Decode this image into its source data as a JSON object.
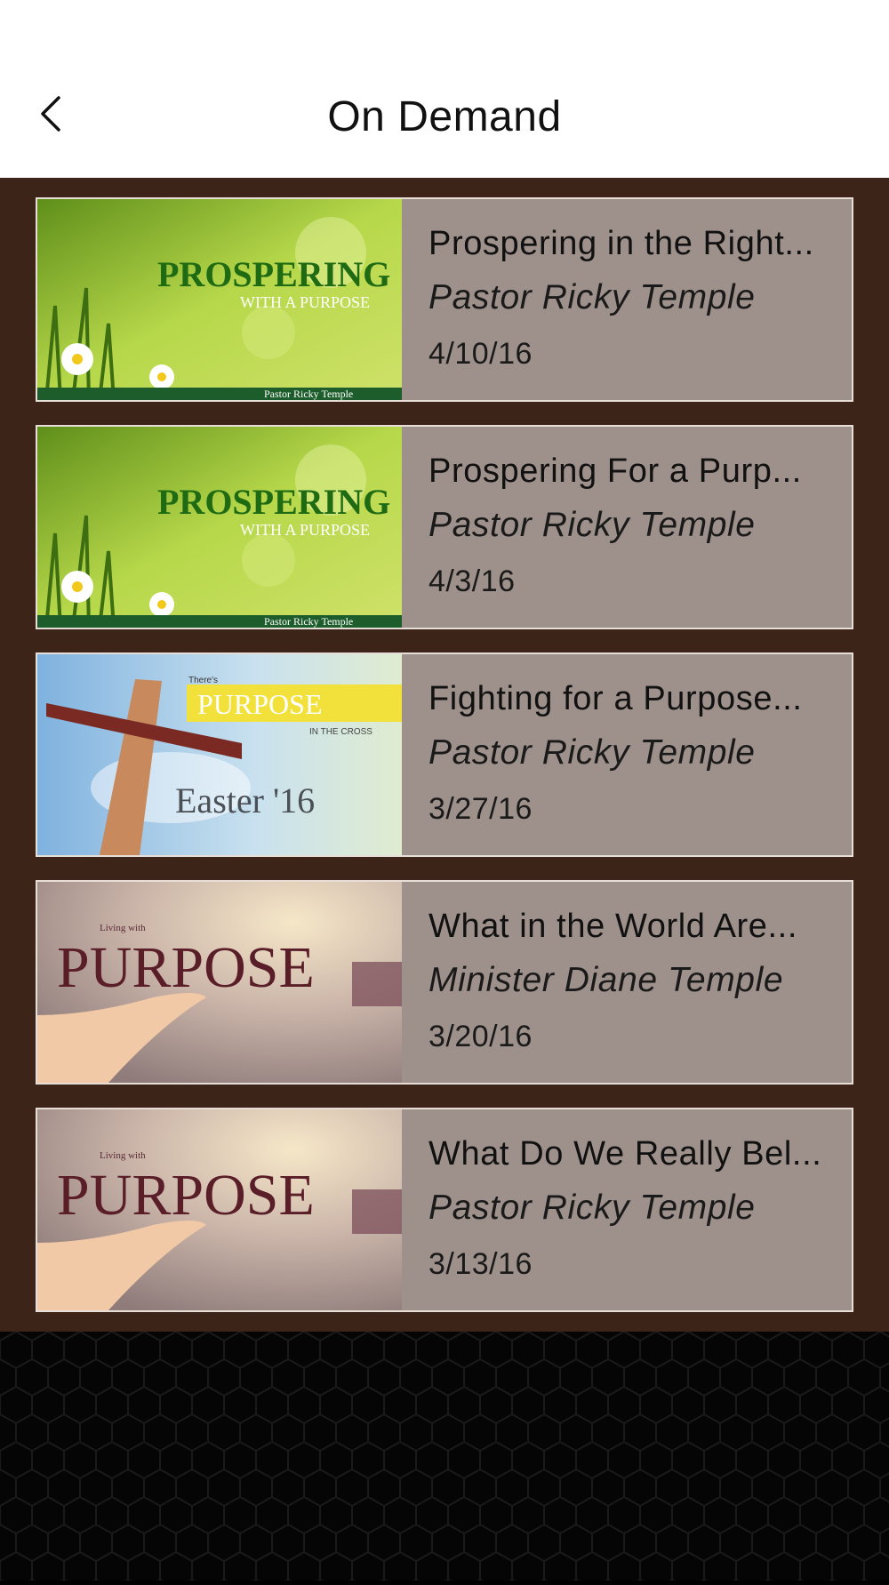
{
  "header": {
    "title": "On Demand",
    "back_icon": "chevron-left-icon"
  },
  "colors": {
    "header_bg": "#ffffff",
    "list_bg": "#3d2418",
    "card_bg": "#9e908a",
    "footer_bg": "#050505"
  },
  "items": [
    {
      "title": "Prospering in the Right...",
      "speaker": "Pastor Ricky Temple",
      "date": "4/10/16",
      "thumb": {
        "line1": "PROSPERING",
        "line2": "WITH A PURPOSE",
        "footer": "Pastor Ricky Temple"
      }
    },
    {
      "title": "Prospering For a Purp...",
      "speaker": "Pastor Ricky Temple",
      "date": "4/3/16",
      "thumb": {
        "line1": "PROSPERING",
        "line2": "WITH A PURPOSE",
        "footer": "Pastor Ricky Temple"
      }
    },
    {
      "title": "Fighting for a Purpose...",
      "speaker": "Pastor Ricky Temple",
      "date": "3/27/16",
      "thumb": {
        "small": "There's",
        "line1": "PURPOSE",
        "line2": "IN THE CROSS",
        "footer": "Easter '16"
      }
    },
    {
      "title": "What in the World Are...",
      "speaker": "Minister Diane Temple",
      "date": "3/20/16",
      "thumb": {
        "small": "Living with",
        "line1": "PURPOSE"
      }
    },
    {
      "title": "What Do We Really Bel...",
      "speaker": "Pastor Ricky Temple",
      "date": "3/13/16",
      "thumb": {
        "small": "Living with",
        "line1": "PURPOSE"
      }
    }
  ]
}
